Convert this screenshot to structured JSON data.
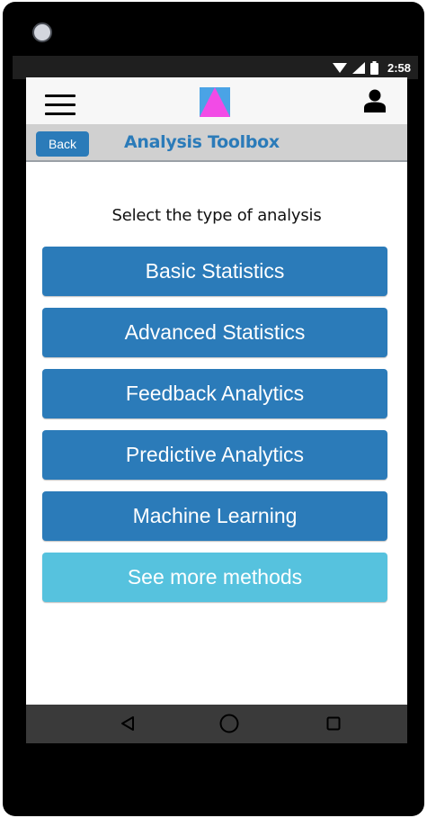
{
  "status_bar": {
    "time": "2:58",
    "icons": [
      "wifi-icon",
      "cellular-signal-icon",
      "battery-icon"
    ]
  },
  "header": {
    "menu_icon": "hamburger-menu-icon",
    "logo_icon": "app-logo-triangle-icon",
    "profile_icon": "user-profile-icon",
    "logo_colors": {
      "background": "#4aa3e6",
      "triangle": "#f24be6"
    }
  },
  "title_bar": {
    "back_label": "Back",
    "title": "Analysis Toolbox"
  },
  "main": {
    "prompt": "Select the type of analysis",
    "buttons": [
      {
        "label": "Basic Statistics",
        "color": "#2b7bb9"
      },
      {
        "label": "Advanced Statistics",
        "color": "#2b7bb9"
      },
      {
        "label": "Feedback Analytics",
        "color": "#2b7bb9"
      },
      {
        "label": "Predictive Analytics",
        "color": "#2b7bb9"
      },
      {
        "label": "Machine Learning",
        "color": "#2b7bb9"
      },
      {
        "label": "See more methods",
        "color": "#56c2de"
      }
    ]
  },
  "nav_bar": {
    "items": [
      "back-triangle-icon",
      "home-circle-icon",
      "recents-square-icon"
    ]
  },
  "colors": {
    "primary": "#2b7bb9",
    "secondary": "#56c2de",
    "title_bar_bg": "#d0d0d0"
  }
}
